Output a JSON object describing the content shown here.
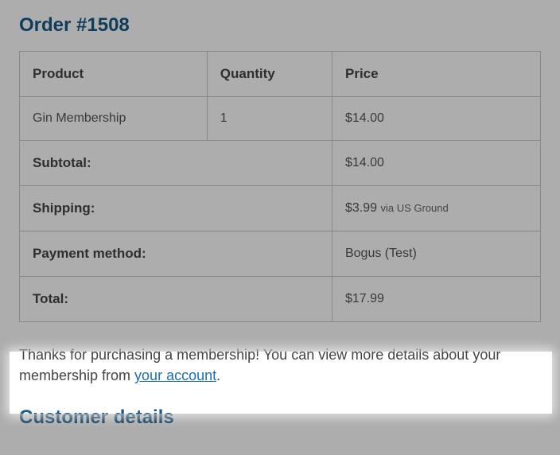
{
  "order": {
    "heading": "Order #1508",
    "columns": {
      "product": "Product",
      "quantity": "Quantity",
      "price": "Price"
    },
    "line_item": {
      "name": "Gin Membership",
      "qty": "1",
      "price": "$14.00"
    },
    "subtotal": {
      "label": "Subtotal:",
      "value": "$14.00"
    },
    "shipping": {
      "label": "Shipping:",
      "amount": "$3.99",
      "method": "via US Ground"
    },
    "payment": {
      "label": "Payment method:",
      "value": "Bogus (Test)"
    },
    "total": {
      "label": "Total:",
      "value": "$17.99"
    }
  },
  "message": {
    "pre": "Thanks for purchasing a membership! You can view more details about your membership from ",
    "link": "your account",
    "post": "."
  },
  "customer_heading": "Customer details"
}
